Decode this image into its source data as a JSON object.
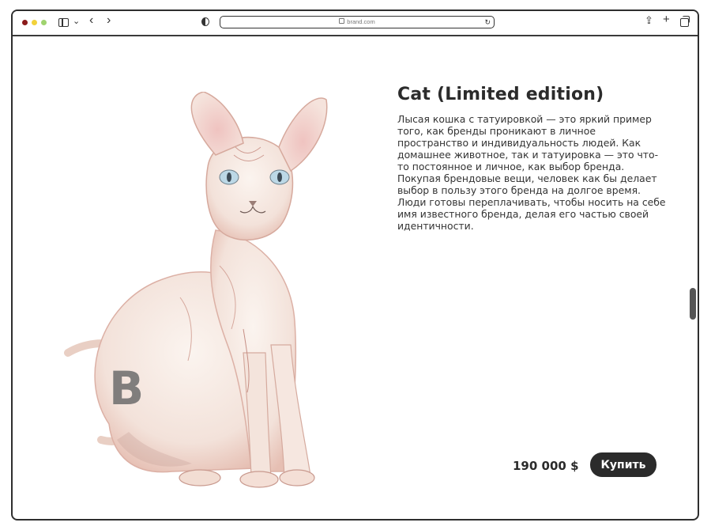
{
  "browser": {
    "address": "brand.com"
  },
  "product": {
    "title": "Cat (Limited edition)",
    "description": "Лысая кошка с татуировкой — это яркий пример того, как бренды проникают в личное пространство и индивидуальность людей. Как домашнее животное, так и татуировка — это что-то постоянное и личное, как выбор бренда. Покупая брендовые вещи, человек как бы делает выбор в пользу этого бренда на долгое время. Люди готовы переплачивать, чтобы носить на себе имя известного бренда, делая его частью своей идентичности.",
    "price": "190 000 $",
    "buy_label": "Купить",
    "image_icon": "sphynx-cat-illustration",
    "tattoo_letter": "B"
  },
  "colors": {
    "accent": "#2b2b2b",
    "cat_skin": "#f6e9e2",
    "cat_shadow": "#e3b7ad",
    "eye": "#bcd8e6"
  }
}
